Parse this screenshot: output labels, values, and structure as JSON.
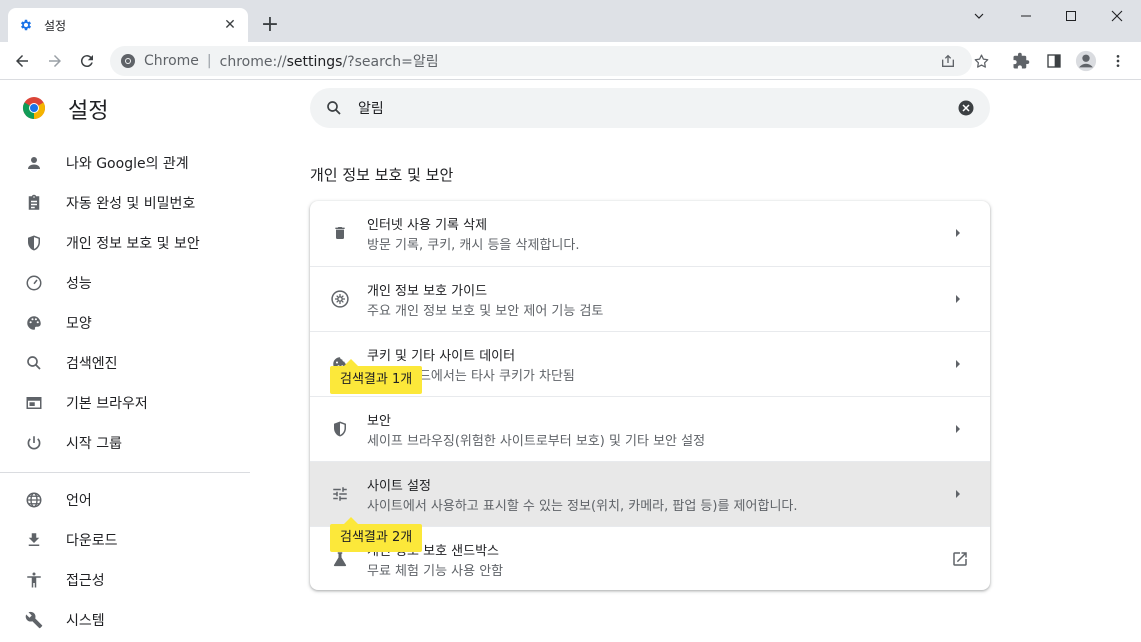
{
  "tab": {
    "title": "설정",
    "close": "✕",
    "new_tab": "+"
  },
  "window": {
    "minimize": "minimize",
    "maximize": "maximize",
    "close": "close"
  },
  "omnibox": {
    "origin": "Chrome",
    "separator": "|",
    "url_prefix": "chrome://",
    "url_host": "settings",
    "url_rest": "/?search=알림"
  },
  "app": {
    "title": "설정"
  },
  "sidebar": {
    "items": [
      {
        "label": "나와 Google의 관계",
        "icon": "person-icon"
      },
      {
        "label": "자동 완성 및 비밀번호",
        "icon": "clipboard-icon"
      },
      {
        "label": "개인 정보 보호 및 보안",
        "icon": "shield-icon"
      },
      {
        "label": "성능",
        "icon": "speedometer-icon"
      },
      {
        "label": "모양",
        "icon": "palette-icon"
      },
      {
        "label": "검색엔진",
        "icon": "search-icon"
      },
      {
        "label": "기본 브라우저",
        "icon": "browser-icon"
      },
      {
        "label": "시작 그룹",
        "icon": "power-icon"
      }
    ],
    "items2": [
      {
        "label": "언어",
        "icon": "globe-icon"
      },
      {
        "label": "다운로드",
        "icon": "download-icon"
      },
      {
        "label": "접근성",
        "icon": "accessibility-icon"
      },
      {
        "label": "시스템",
        "icon": "wrench-icon"
      }
    ]
  },
  "search": {
    "value": "알림"
  },
  "section": {
    "title": "개인 정보 보호 및 보안"
  },
  "rows": [
    {
      "title": "인터넷 사용 기록 삭제",
      "subtitle": "방문 기록, 쿠키, 캐시 등을 삭제합니다.",
      "icon": "trash-icon"
    },
    {
      "title": "개인 정보 보호 가이드",
      "subtitle": "주요 개인 정보 보호 및 보안 제어 기능 검토",
      "icon": "compass-icon"
    },
    {
      "title": "쿠키 및 기타 사이트 데이터",
      "subtitle": "시크릿 모드에서는 타사 쿠키가 차단됨",
      "icon": "cookie-icon"
    },
    {
      "title": "보안",
      "subtitle": "세이프 브라우징(위험한 사이트로부터 보호) 및 기타 보안 설정",
      "icon": "shield-icon"
    },
    {
      "title": "사이트 설정",
      "subtitle": "사이트에서 사용하고 표시할 수 있는 정보(위치, 카메라, 팝업 등)를 제어합니다.",
      "icon": "tune-icon"
    },
    {
      "title": "개인 정보 보호 샌드박스",
      "subtitle": "무료 체험 기능 사용 안함",
      "icon": "flask-icon"
    }
  ],
  "bubbles": {
    "first": "검색결과 1개",
    "second": "검색결과 2개"
  },
  "colors": {
    "highlight": "#fce83a",
    "hovered_row": "#e8e8e8",
    "accent": "#1a73e8"
  }
}
